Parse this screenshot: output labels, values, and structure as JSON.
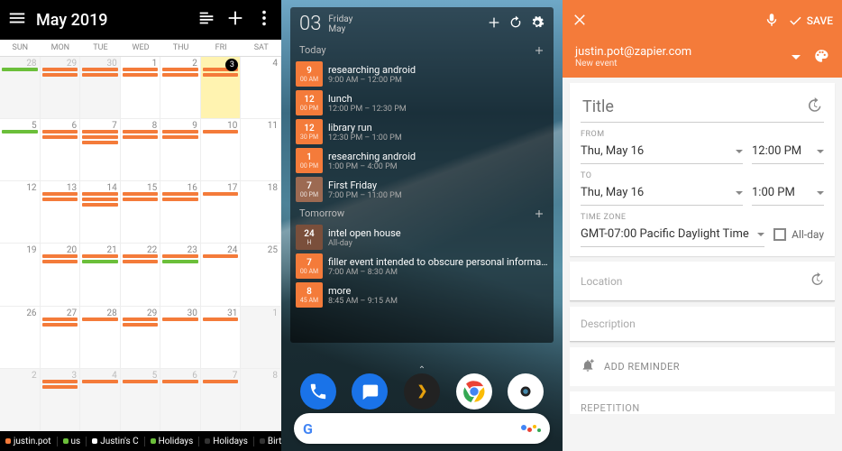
{
  "colors": {
    "accent": "#f47b3a",
    "orange": "#f47b3a",
    "green": "#6bbf3a",
    "brown": "#9c6a52",
    "darkbrown": "#7a4f3b"
  },
  "panelA": {
    "title": "May 2019",
    "dow": [
      "SUN",
      "MON",
      "TUE",
      "WED",
      "THU",
      "FRI",
      "SAT"
    ],
    "todayDay": 3,
    "weeks": [
      {
        "days": [
          {
            "n": 28,
            "other": true,
            "ev": [
              {
                "c": "#6bbf3a"
              }
            ]
          },
          {
            "n": 29,
            "other": true,
            "ev": [
              {
                "c": "#f47b3a"
              },
              {
                "c": "#f47b3a"
              }
            ]
          },
          {
            "n": 30,
            "other": true,
            "ev": [
              {
                "c": "#f47b3a"
              },
              {
                "c": "#f47b3a"
              }
            ]
          },
          {
            "n": 1,
            "ev": [
              {
                "c": "#f47b3a"
              },
              {
                "c": "#f47b3a"
              }
            ]
          },
          {
            "n": 2,
            "ev": [
              {
                "c": "#f47b3a"
              },
              {
                "c": "#f47b3a"
              }
            ]
          },
          {
            "n": 3,
            "today": true,
            "ev": [
              {
                "c": "#f47b3a"
              },
              {
                "c": "#f47b3a"
              }
            ]
          },
          {
            "n": 4,
            "ev": []
          }
        ]
      },
      {
        "days": [
          {
            "n": 5,
            "ev": [
              {
                "c": "#6bbf3a"
              }
            ]
          },
          {
            "n": 6,
            "ev": [
              {
                "c": "#f47b3a"
              },
              {
                "c": "#f47b3a"
              }
            ]
          },
          {
            "n": 7,
            "ev": [
              {
                "c": "#f47b3a"
              },
              {
                "c": "#f47b3a"
              },
              {
                "c": "#f47b3a"
              }
            ]
          },
          {
            "n": 8,
            "ev": [
              {
                "c": "#f47b3a"
              },
              {
                "c": "#f47b3a"
              }
            ]
          },
          {
            "n": 9,
            "ev": [
              {
                "c": "#f47b3a"
              },
              {
                "c": "#f47b3a"
              }
            ]
          },
          {
            "n": 10,
            "ev": [
              {
                "c": "#f47b3a"
              }
            ]
          },
          {
            "n": 11,
            "ev": []
          }
        ]
      },
      {
        "days": [
          {
            "n": 12,
            "ev": []
          },
          {
            "n": 13,
            "ev": [
              {
                "c": "#f47b3a"
              },
              {
                "c": "#f47b3a"
              }
            ]
          },
          {
            "n": 14,
            "ev": [
              {
                "c": "#f47b3a"
              },
              {
                "c": "#f47b3a"
              },
              {
                "c": "#f47b3a"
              }
            ]
          },
          {
            "n": 15,
            "ev": [
              {
                "c": "#f47b3a"
              },
              {
                "c": "#f47b3a"
              }
            ]
          },
          {
            "n": 16,
            "ev": [
              {
                "c": "#f47b3a"
              },
              {
                "c": "#f47b3a"
              }
            ]
          },
          {
            "n": 17,
            "ev": [
              {
                "c": "#f47b3a"
              }
            ]
          },
          {
            "n": 18,
            "ev": []
          }
        ]
      },
      {
        "days": [
          {
            "n": 19,
            "ev": []
          },
          {
            "n": 20,
            "ev": [
              {
                "c": "#f47b3a"
              },
              {
                "c": "#f47b3a"
              }
            ]
          },
          {
            "n": 21,
            "ev": [
              {
                "c": "#f47b3a"
              },
              {
                "c": "#6bbf3a"
              }
            ]
          },
          {
            "n": 22,
            "ev": [
              {
                "c": "#f47b3a"
              },
              {
                "c": "#f47b3a"
              }
            ]
          },
          {
            "n": 23,
            "ev": [
              {
                "c": "#f47b3a"
              },
              {
                "c": "#6bbf3a"
              }
            ]
          },
          {
            "n": 24,
            "ev": [
              {
                "c": "#f47b3a"
              }
            ]
          },
          {
            "n": 25,
            "ev": []
          }
        ]
      },
      {
        "days": [
          {
            "n": 26,
            "ev": []
          },
          {
            "n": 27,
            "ev": [
              {
                "c": "#f47b3a"
              },
              {
                "c": "#f47b3a"
              }
            ]
          },
          {
            "n": 28,
            "ev": [
              {
                "c": "#f47b3a"
              }
            ]
          },
          {
            "n": 29,
            "ev": [
              {
                "c": "#f47b3a"
              },
              {
                "c": "#f47b3a"
              }
            ]
          },
          {
            "n": 30,
            "ev": [
              {
                "c": "#f47b3a"
              }
            ]
          },
          {
            "n": 31,
            "ev": [
              {
                "c": "#f47b3a"
              }
            ]
          },
          {
            "n": 1,
            "other": true,
            "ev": []
          }
        ]
      },
      {
        "days": [
          {
            "n": 2,
            "other": true,
            "ev": []
          },
          {
            "n": 3,
            "other": true,
            "ev": [
              {
                "c": "#f47b3a"
              },
              {
                "c": "#f47b3a"
              }
            ]
          },
          {
            "n": 4,
            "other": true,
            "ev": [
              {
                "c": "#f47b3a"
              }
            ]
          },
          {
            "n": 5,
            "other": true,
            "ev": [
              {
                "c": "#f47b3a"
              }
            ]
          },
          {
            "n": 6,
            "other": true,
            "ev": [
              {
                "c": "#f47b3a"
              }
            ]
          },
          {
            "n": 7,
            "other": true,
            "ev": [
              {
                "c": "#f47b3a"
              }
            ]
          },
          {
            "n": 8,
            "other": true,
            "ev": []
          }
        ]
      }
    ],
    "footer": [
      {
        "label": "justin.pot",
        "c": "#f47b3a"
      },
      {
        "label": "us",
        "c": "#6bbf3a"
      },
      {
        "label": "Justin's C",
        "c": "#fff"
      },
      {
        "label": "Holidays",
        "c": "#6bbf3a"
      },
      {
        "label": "Holidays",
        "c": "#333"
      },
      {
        "label": "Birthdays",
        "c": "#333"
      }
    ]
  },
  "panelB": {
    "dateNum": "03",
    "weekday": "Friday",
    "month": "May",
    "sections": [
      {
        "label": "Today",
        "add": true,
        "items": [
          {
            "h": "9",
            "ap": "00\nAM",
            "bg": "#f47b3a",
            "title": "researching android",
            "sub": "9:00 AM – 12:00 PM"
          },
          {
            "h": "12",
            "ap": "00\nPM",
            "bg": "#f47b3a",
            "title": "lunch",
            "sub": "12:00 PM – 12:30 PM"
          },
          {
            "h": "12",
            "ap": "30\nPM",
            "bg": "#f47b3a",
            "title": "library run",
            "sub": "12:30 PM – 1:00 PM"
          },
          {
            "h": "1",
            "ap": "00\nPM",
            "bg": "#f47b3a",
            "title": "researching android",
            "sub": "1:00 PM – 4:00 PM"
          },
          {
            "h": "7",
            "ap": "00\nPM",
            "bg": "#9c6a52",
            "title": "First Friday",
            "sub": "7:00 PM – 11:00 PM"
          }
        ]
      },
      {
        "label": "Tomorrow",
        "add": true,
        "items": [
          {
            "h": "24",
            "ap": "H",
            "bg": "#7a4f3b",
            "title": "intel open house",
            "sub": "All-day"
          },
          {
            "h": "7",
            "ap": "00\nAM",
            "bg": "#f47b3a",
            "title": "filler event intended to obscure personal information in s…",
            "sub": "7:00 AM – 8:30 AM"
          },
          {
            "h": "8",
            "ap": "45\nAM",
            "bg": "#f47b3a",
            "title": "more",
            "sub": "8:45 AM – 9:15 AM"
          }
        ]
      }
    ],
    "dock": [
      {
        "name": "phone",
        "bg": "#1a73e8"
      },
      {
        "name": "messages",
        "bg": "#1a73e8"
      },
      {
        "name": "plex",
        "bg": "#222"
      },
      {
        "name": "chrome",
        "bg": "#fff"
      },
      {
        "name": "camera",
        "bg": "#fff"
      }
    ],
    "searchG": "G"
  },
  "panelC": {
    "save": "SAVE",
    "email": "justin.pot@zapier.com",
    "subtitle": "New event",
    "titlePlaceholder": "Title",
    "fromLabel": "FROM",
    "fromDate": "Thu, May 16",
    "fromTime": "12:00 PM",
    "toLabel": "TO",
    "toDate": "Thu, May 16",
    "toTime": "1:00 PM",
    "tzLabel": "TIME ZONE",
    "tz": "GMT-07:00 Pacific Daylight Time",
    "allDay": "All-day",
    "location": "Location",
    "description": "Description",
    "addReminder": "ADD REMINDER",
    "repetition": "REPETITION"
  }
}
